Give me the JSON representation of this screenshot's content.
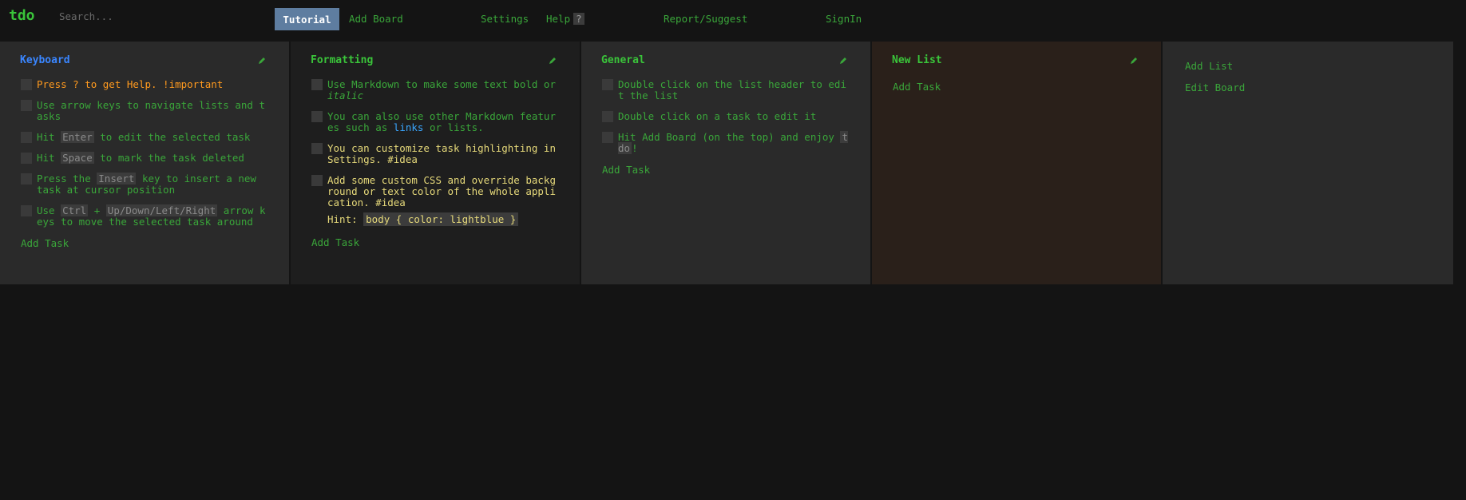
{
  "app": {
    "logo": "tdo"
  },
  "search": {
    "placeholder": "Search..."
  },
  "nav": {
    "tutorial": "Tutorial",
    "add_board": "Add Board",
    "settings": "Settings",
    "help": "Help",
    "help_badge": "?",
    "report": "Report/Suggest",
    "signin": "SignIn"
  },
  "colors": {
    "accent": "#3aa63a",
    "title_blue": "#3a86ff",
    "title_green": "#3ac43a",
    "highlight_orange": "#ff9a1f",
    "highlight_yellow": "#e6d97a",
    "panel_dark": "#2a2a2a",
    "panel_darker": "#1e1e1e",
    "panel_brown": "#2a201a",
    "tab_active": "#5e7da0"
  },
  "lists": [
    {
      "title": "Keyboard",
      "tasks": [
        {
          "parts": [
            "Press ? to get Help. !important"
          ]
        },
        {
          "parts": [
            "Use arrow keys to navigate lists and tasks"
          ]
        },
        {
          "parts": [
            "Hit ",
            "Enter",
            " to edit the selected task"
          ]
        },
        {
          "parts": [
            "Hit ",
            "Space",
            " to mark the task deleted"
          ]
        },
        {
          "parts": [
            "Press the ",
            "Insert",
            " key to insert a new task at cursor position"
          ]
        },
        {
          "parts": [
            "Use ",
            "Ctrl",
            " + ",
            "Up/Down/Left/Right",
            " arrow keys to move the selected task around"
          ]
        }
      ],
      "add_task": "Add Task"
    },
    {
      "title": "Formatting",
      "tasks": [
        {
          "parts": [
            "Use Markdown to make some text bold or ",
            "italic"
          ]
        },
        {
          "parts": [
            "You can also use other Markdown features such as ",
            "links",
            " or lists."
          ]
        },
        {
          "parts": [
            "You can customize task highlighting in Settings. #idea"
          ]
        },
        {
          "parts": [
            "Add some custom CSS and override background or text color of the whole application. #idea"
          ]
        }
      ],
      "hint_label": "Hint: ",
      "hint_code": "body { color: lightblue }",
      "add_task": "Add Task"
    },
    {
      "title": "General",
      "tasks": [
        {
          "parts": [
            "Double click on the list header to edit the list"
          ]
        },
        {
          "parts": [
            "Double click on a task to edit it"
          ]
        },
        {
          "parts": [
            "Hit Add Board (on the top) and enjoy ",
            "tdo",
            "!"
          ]
        }
      ],
      "add_task": "Add Task"
    },
    {
      "title": "New List",
      "tasks": [],
      "add_task": "Add Task"
    }
  ],
  "side": {
    "add_list": "Add List",
    "edit_board": "Edit Board"
  }
}
